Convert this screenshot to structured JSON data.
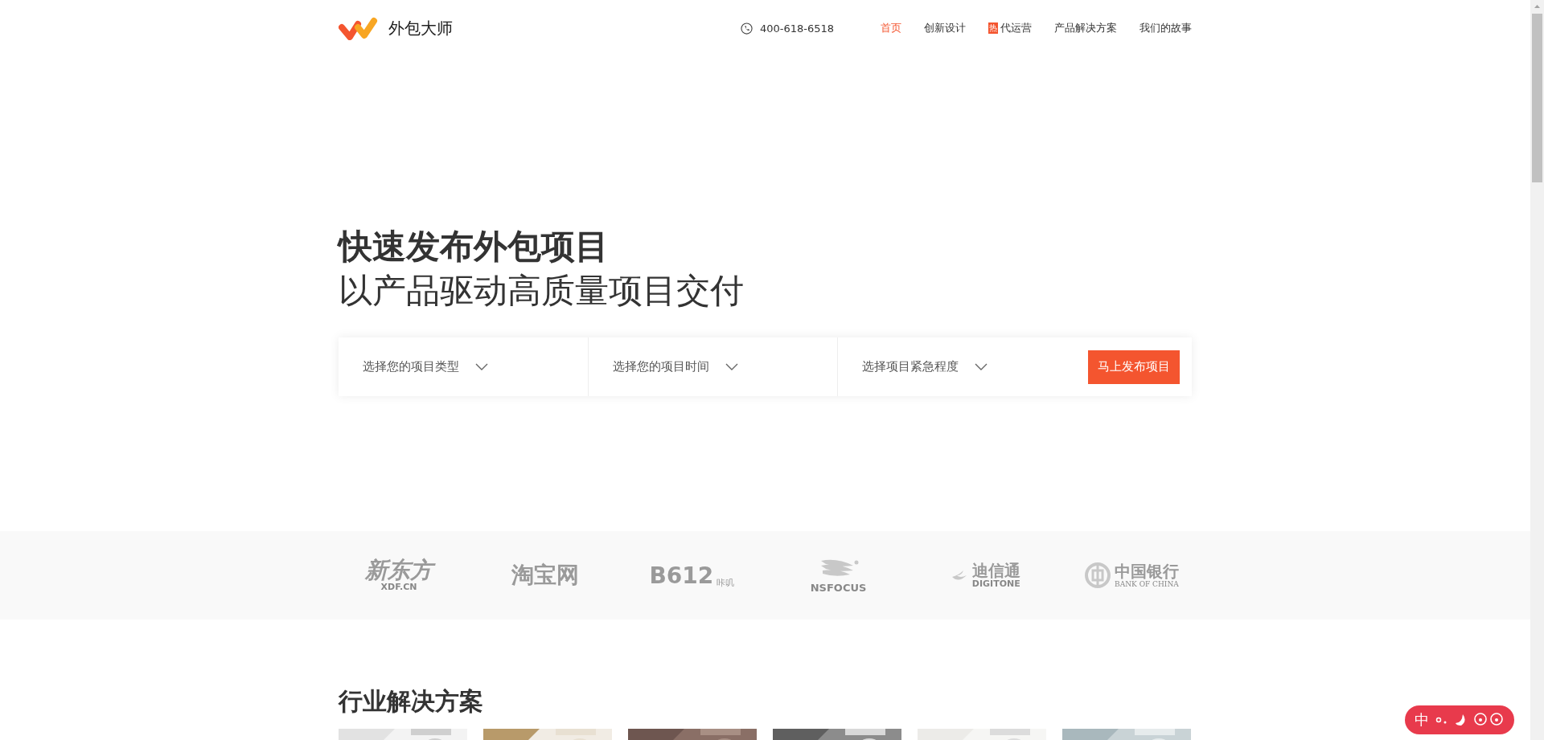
{
  "header": {
    "brand": "外包大师",
    "phone": "400-618-6518",
    "nav": [
      {
        "label": "首页",
        "selected": true
      },
      {
        "label": "创新设计",
        "selected": false
      },
      {
        "label": "代运营",
        "selected": false,
        "badge": "热"
      },
      {
        "label": "产品解决方案",
        "selected": false
      },
      {
        "label": "我们的故事",
        "selected": false
      }
    ]
  },
  "hero": {
    "title": "快速发布外包项目",
    "subtitle": "以产品驱动高质量项目交付",
    "selects": [
      {
        "label": "选择您的项目类型"
      },
      {
        "label": "选择您的项目时间"
      },
      {
        "label": "选择项目紧急程度"
      }
    ],
    "button": "马上发布项目"
  },
  "clients": [
    {
      "kind": "stacked",
      "main": "新东方",
      "sub": "XDF.CN"
    },
    {
      "kind": "plain",
      "main": "淘宝网"
    },
    {
      "kind": "side",
      "main": "B612",
      "sub": "咔叽"
    },
    {
      "kind": "flag",
      "main": "NSFOCUS"
    },
    {
      "kind": "iconstack",
      "main": "迪信通",
      "sub": "DIGITONE"
    },
    {
      "kind": "coin",
      "main": "中国银行",
      "sub": "BANK OF CHINA"
    }
  ],
  "section": {
    "title": "行业解决方案"
  },
  "ime_toolbar": {
    "label": "中"
  }
}
